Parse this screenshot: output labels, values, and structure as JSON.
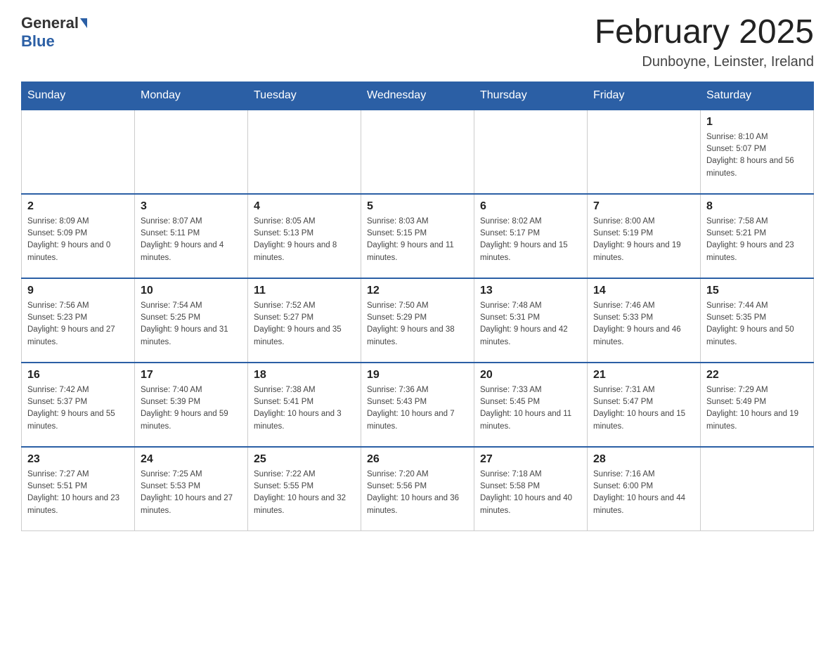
{
  "header": {
    "logo_general": "General",
    "logo_blue": "Blue",
    "title": "February 2025",
    "subtitle": "Dunboyne, Leinster, Ireland"
  },
  "weekdays": [
    "Sunday",
    "Monday",
    "Tuesday",
    "Wednesday",
    "Thursday",
    "Friday",
    "Saturday"
  ],
  "weeks": [
    [
      {
        "day": "",
        "info": ""
      },
      {
        "day": "",
        "info": ""
      },
      {
        "day": "",
        "info": ""
      },
      {
        "day": "",
        "info": ""
      },
      {
        "day": "",
        "info": ""
      },
      {
        "day": "",
        "info": ""
      },
      {
        "day": "1",
        "info": "Sunrise: 8:10 AM\nSunset: 5:07 PM\nDaylight: 8 hours and 56 minutes."
      }
    ],
    [
      {
        "day": "2",
        "info": "Sunrise: 8:09 AM\nSunset: 5:09 PM\nDaylight: 9 hours and 0 minutes."
      },
      {
        "day": "3",
        "info": "Sunrise: 8:07 AM\nSunset: 5:11 PM\nDaylight: 9 hours and 4 minutes."
      },
      {
        "day": "4",
        "info": "Sunrise: 8:05 AM\nSunset: 5:13 PM\nDaylight: 9 hours and 8 minutes."
      },
      {
        "day": "5",
        "info": "Sunrise: 8:03 AM\nSunset: 5:15 PM\nDaylight: 9 hours and 11 minutes."
      },
      {
        "day": "6",
        "info": "Sunrise: 8:02 AM\nSunset: 5:17 PM\nDaylight: 9 hours and 15 minutes."
      },
      {
        "day": "7",
        "info": "Sunrise: 8:00 AM\nSunset: 5:19 PM\nDaylight: 9 hours and 19 minutes."
      },
      {
        "day": "8",
        "info": "Sunrise: 7:58 AM\nSunset: 5:21 PM\nDaylight: 9 hours and 23 minutes."
      }
    ],
    [
      {
        "day": "9",
        "info": "Sunrise: 7:56 AM\nSunset: 5:23 PM\nDaylight: 9 hours and 27 minutes."
      },
      {
        "day": "10",
        "info": "Sunrise: 7:54 AM\nSunset: 5:25 PM\nDaylight: 9 hours and 31 minutes."
      },
      {
        "day": "11",
        "info": "Sunrise: 7:52 AM\nSunset: 5:27 PM\nDaylight: 9 hours and 35 minutes."
      },
      {
        "day": "12",
        "info": "Sunrise: 7:50 AM\nSunset: 5:29 PM\nDaylight: 9 hours and 38 minutes."
      },
      {
        "day": "13",
        "info": "Sunrise: 7:48 AM\nSunset: 5:31 PM\nDaylight: 9 hours and 42 minutes."
      },
      {
        "day": "14",
        "info": "Sunrise: 7:46 AM\nSunset: 5:33 PM\nDaylight: 9 hours and 46 minutes."
      },
      {
        "day": "15",
        "info": "Sunrise: 7:44 AM\nSunset: 5:35 PM\nDaylight: 9 hours and 50 minutes."
      }
    ],
    [
      {
        "day": "16",
        "info": "Sunrise: 7:42 AM\nSunset: 5:37 PM\nDaylight: 9 hours and 55 minutes."
      },
      {
        "day": "17",
        "info": "Sunrise: 7:40 AM\nSunset: 5:39 PM\nDaylight: 9 hours and 59 minutes."
      },
      {
        "day": "18",
        "info": "Sunrise: 7:38 AM\nSunset: 5:41 PM\nDaylight: 10 hours and 3 minutes."
      },
      {
        "day": "19",
        "info": "Sunrise: 7:36 AM\nSunset: 5:43 PM\nDaylight: 10 hours and 7 minutes."
      },
      {
        "day": "20",
        "info": "Sunrise: 7:33 AM\nSunset: 5:45 PM\nDaylight: 10 hours and 11 minutes."
      },
      {
        "day": "21",
        "info": "Sunrise: 7:31 AM\nSunset: 5:47 PM\nDaylight: 10 hours and 15 minutes."
      },
      {
        "day": "22",
        "info": "Sunrise: 7:29 AM\nSunset: 5:49 PM\nDaylight: 10 hours and 19 minutes."
      }
    ],
    [
      {
        "day": "23",
        "info": "Sunrise: 7:27 AM\nSunset: 5:51 PM\nDaylight: 10 hours and 23 minutes."
      },
      {
        "day": "24",
        "info": "Sunrise: 7:25 AM\nSunset: 5:53 PM\nDaylight: 10 hours and 27 minutes."
      },
      {
        "day": "25",
        "info": "Sunrise: 7:22 AM\nSunset: 5:55 PM\nDaylight: 10 hours and 32 minutes."
      },
      {
        "day": "26",
        "info": "Sunrise: 7:20 AM\nSunset: 5:56 PM\nDaylight: 10 hours and 36 minutes."
      },
      {
        "day": "27",
        "info": "Sunrise: 7:18 AM\nSunset: 5:58 PM\nDaylight: 10 hours and 40 minutes."
      },
      {
        "day": "28",
        "info": "Sunrise: 7:16 AM\nSunset: 6:00 PM\nDaylight: 10 hours and 44 minutes."
      },
      {
        "day": "",
        "info": ""
      }
    ]
  ]
}
